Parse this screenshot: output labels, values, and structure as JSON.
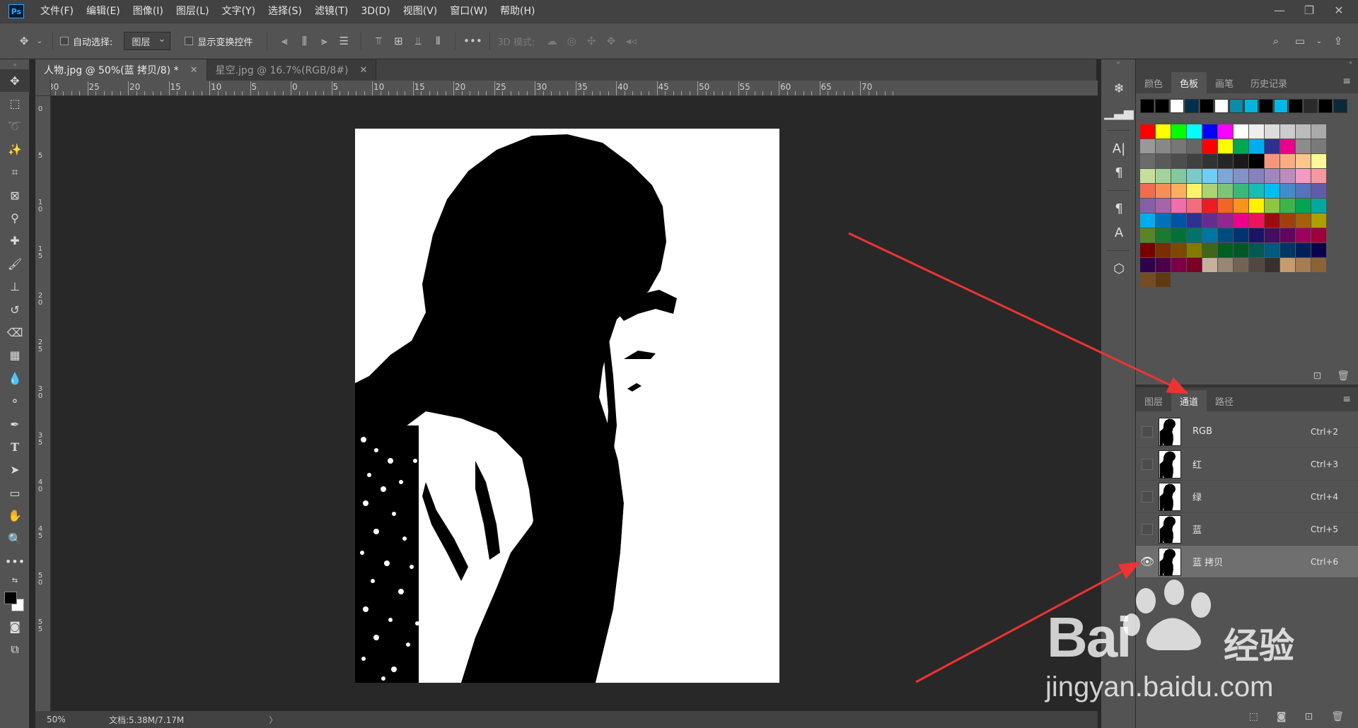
{
  "app": {
    "logo": "Ps",
    "menus": [
      "文件(F)",
      "编辑(E)",
      "图像(I)",
      "图层(L)",
      "文字(Y)",
      "选择(S)",
      "滤镜(T)",
      "3D(D)",
      "视图(V)",
      "窗口(W)",
      "帮助(H)"
    ],
    "window_controls": [
      "minimize-icon",
      "restore-icon",
      "close-icon"
    ]
  },
  "options": {
    "auto_select_label": "自动选择:",
    "auto_select_value": "图层",
    "show_transform_label": "显示变换控件",
    "mode_3d_label": "3D 模式:"
  },
  "tabs": [
    {
      "title": "人物.jpg @ 50%(蓝 拷贝/8) *",
      "active": true
    },
    {
      "title": "星空.jpg @ 16.7%(RGB/8#)",
      "active": false
    }
  ],
  "rulers": {
    "top_labels": [
      "30",
      "25",
      "20",
      "15",
      "10",
      "5",
      "0",
      "5",
      "10",
      "15",
      "20",
      "25",
      "30",
      "35",
      "40",
      "45",
      "50",
      "55",
      "60",
      "65",
      "70"
    ],
    "left_labels": [
      "0",
      "5",
      "1 0",
      "1 5",
      "2 0",
      "2 5",
      "3 0",
      "3 5",
      "4 0",
      "4 5",
      "5 0",
      "5 5"
    ]
  },
  "status": {
    "zoom": "50%",
    "doc_size": "文档:5.38M/7.17M",
    "arrow": "〉"
  },
  "swatch_panel": {
    "tabs": [
      "颜色",
      "色板",
      "画笔",
      "历史记录"
    ],
    "active_tab": "色板",
    "recent": [
      "#000000",
      "#000000",
      "#ffffff",
      "#002f4f",
      "#000000",
      "#ffffff",
      "#0f8aa8",
      "#00b6e0",
      "#000000",
      "#00b8e8",
      "#000000",
      "#2a2a2a",
      "#000000",
      "#0a2a3a"
    ],
    "colors": [
      "#ff0000",
      "#ffff00",
      "#00ff00",
      "#00ffff",
      "#0000ff",
      "#ff00ff",
      "#ffffff",
      "#eeeeee",
      "#dddddd",
      "#cccccc",
      "#bbbbbb",
      "#aaaaaa",
      "#999999",
      "#888888",
      "#777777",
      "#666666",
      "#ff0000",
      "#ffff00",
      "#00a651",
      "#00aeef",
      "#2e3192",
      "#ec008c",
      "#8c8c8c",
      "#7a7a7a",
      "#6b6b6b",
      "#5a5a5a",
      "#4d4d4d",
      "#404040",
      "#333333",
      "#262626",
      "#1a1a1a",
      "#000000",
      "#f69679",
      "#f9ad81",
      "#fdc68a",
      "#fff79a",
      "#c4df9b",
      "#a3d39c",
      "#82ca9d",
      "#7accc8",
      "#6dcff6",
      "#7da7d9",
      "#8393ca",
      "#8781bd",
      "#a186be",
      "#bd8cbf",
      "#f49ac2",
      "#f6989d",
      "#f26c4f",
      "#f68e56",
      "#fbaf5d",
      "#fff467",
      "#acd373",
      "#7cc576",
      "#3bb878",
      "#1abbb4",
      "#00bff3",
      "#438ccb",
      "#5574b9",
      "#605ca8",
      "#8560a8",
      "#a864a8",
      "#f06eaa",
      "#f26d7d",
      "#ed1c24",
      "#f26522",
      "#f7941d",
      "#fff200",
      "#8dc63f",
      "#39b54a",
      "#00a651",
      "#00a99d",
      "#00aeef",
      "#0072bc",
      "#0054a6",
      "#2e3192",
      "#662d91",
      "#92278f",
      "#ec008c",
      "#ed145b",
      "#9e0b0f",
      "#a0410d",
      "#a36209",
      "#aba000",
      "#598527",
      "#1a7b30",
      "#007236",
      "#00746b",
      "#0076a3",
      "#004b80",
      "#003471",
      "#1b1464",
      "#440e62",
      "#630460",
      "#9e005d",
      "#9e0039",
      "#790000",
      "#7b2e00",
      "#7d4900",
      "#827b00",
      "#406618",
      "#005e20",
      "#005826",
      "#005952",
      "#005b7f",
      "#003663",
      "#002157",
      "#0d004c",
      "#32004b",
      "#4b0049",
      "#7b0046",
      "#7a0026",
      "#c7b299",
      "#998675",
      "#736357",
      "#534741",
      "#37302d",
      "#c69c6d",
      "#a67c52",
      "#8c6239",
      "#754c24",
      "#603913"
    ]
  },
  "channels_panel": {
    "tabs": [
      "图层",
      "通道",
      "路径"
    ],
    "active_tab": "通道",
    "channels": [
      {
        "name": "RGB",
        "shortcut": "Ctrl+2",
        "visible": false,
        "selected": false
      },
      {
        "name": "红",
        "shortcut": "Ctrl+3",
        "visible": false,
        "selected": false
      },
      {
        "name": "绿",
        "shortcut": "Ctrl+4",
        "visible": false,
        "selected": false
      },
      {
        "name": "蓝",
        "shortcut": "Ctrl+5",
        "visible": false,
        "selected": false
      },
      {
        "name": "蓝 拷贝",
        "shortcut": "Ctrl+6",
        "visible": true,
        "selected": true
      }
    ]
  },
  "watermark": {
    "brand": "Bai",
    "brand_suffix": "经验",
    "url": "jingyan.baidu.com"
  },
  "colors": {
    "annotation_arrow": "#ee3333",
    "panel_bg": "#535353",
    "canvas_bg": "#282828"
  }
}
